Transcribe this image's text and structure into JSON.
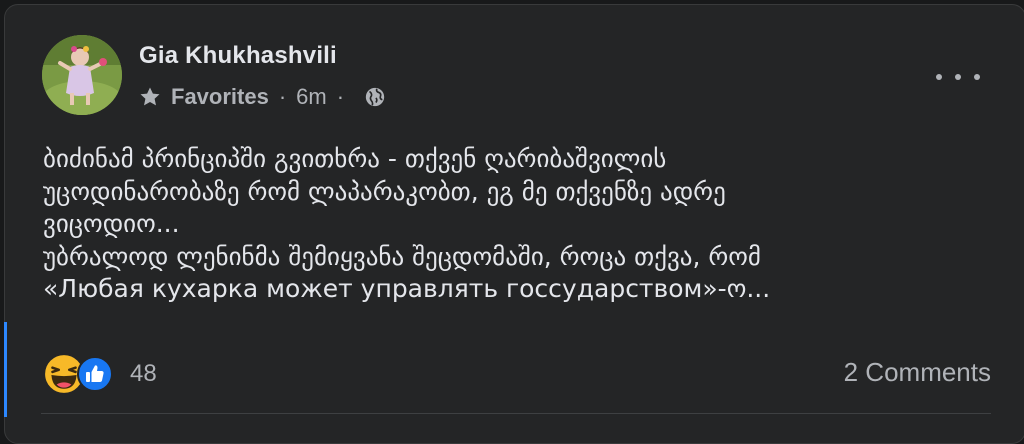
{
  "post": {
    "author": "Gia Khukhashvili",
    "audience": "Favorites",
    "separator": "·",
    "time": "6m",
    "text_lines": [
      "ბიძინამ პრინციპში გვითხრა - თქვენ ღარიბაშვილის",
      "უცოდინარობაზე რომ ლაპარაკობთ, ეგ მე თქვენზე ადრე",
      "ვიცოდიო...",
      "უბრალოდ ლენინმა შემიყვანა შეცდომაში, როცა თქვა, რომ",
      "«Любая кухарка может управлять госсударством»-ო..."
    ]
  },
  "reactions": {
    "count": "48",
    "icons": [
      "haha-icon",
      "like-icon"
    ]
  },
  "comments": {
    "label": "2 Comments"
  },
  "icons": {
    "audience": "star-icon",
    "privacy": "globe-icon",
    "menu": "more-options-icon"
  },
  "colors": {
    "background": "#242526",
    "text": "#e4e6eb",
    "secondary_text": "#b0b3b8",
    "like_blue": "#1877f2",
    "haha_yellow": "#f7b928"
  }
}
